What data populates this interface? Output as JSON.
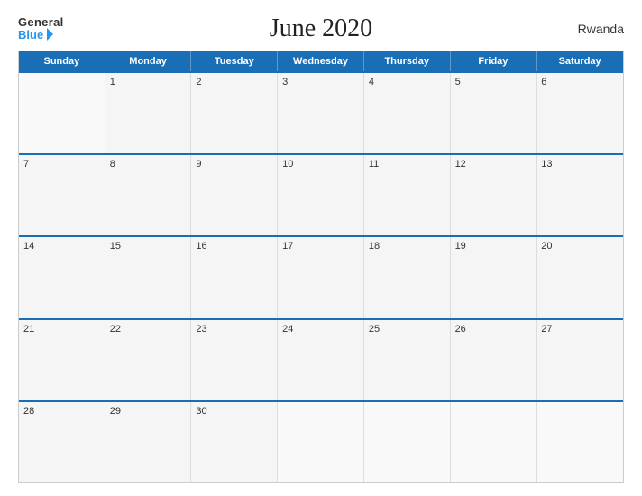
{
  "header": {
    "logo_general": "General",
    "logo_blue": "Blue",
    "title": "June 2020",
    "country": "Rwanda"
  },
  "calendar": {
    "days_of_week": [
      "Sunday",
      "Monday",
      "Tuesday",
      "Wednesday",
      "Thursday",
      "Friday",
      "Saturday"
    ],
    "weeks": [
      [
        {
          "day": "",
          "empty": true
        },
        {
          "day": "1"
        },
        {
          "day": "2"
        },
        {
          "day": "3"
        },
        {
          "day": "4"
        },
        {
          "day": "5"
        },
        {
          "day": "6"
        }
      ],
      [
        {
          "day": "7"
        },
        {
          "day": "8"
        },
        {
          "day": "9"
        },
        {
          "day": "10"
        },
        {
          "day": "11"
        },
        {
          "day": "12"
        },
        {
          "day": "13"
        }
      ],
      [
        {
          "day": "14"
        },
        {
          "day": "15"
        },
        {
          "day": "16"
        },
        {
          "day": "17"
        },
        {
          "day": "18"
        },
        {
          "day": "19"
        },
        {
          "day": "20"
        }
      ],
      [
        {
          "day": "21"
        },
        {
          "day": "22"
        },
        {
          "day": "23"
        },
        {
          "day": "24"
        },
        {
          "day": "25"
        },
        {
          "day": "26"
        },
        {
          "day": "27"
        }
      ],
      [
        {
          "day": "28"
        },
        {
          "day": "29"
        },
        {
          "day": "30"
        },
        {
          "day": "",
          "empty": true
        },
        {
          "day": "",
          "empty": true
        },
        {
          "day": "",
          "empty": true
        },
        {
          "day": "",
          "empty": true
        }
      ]
    ]
  }
}
